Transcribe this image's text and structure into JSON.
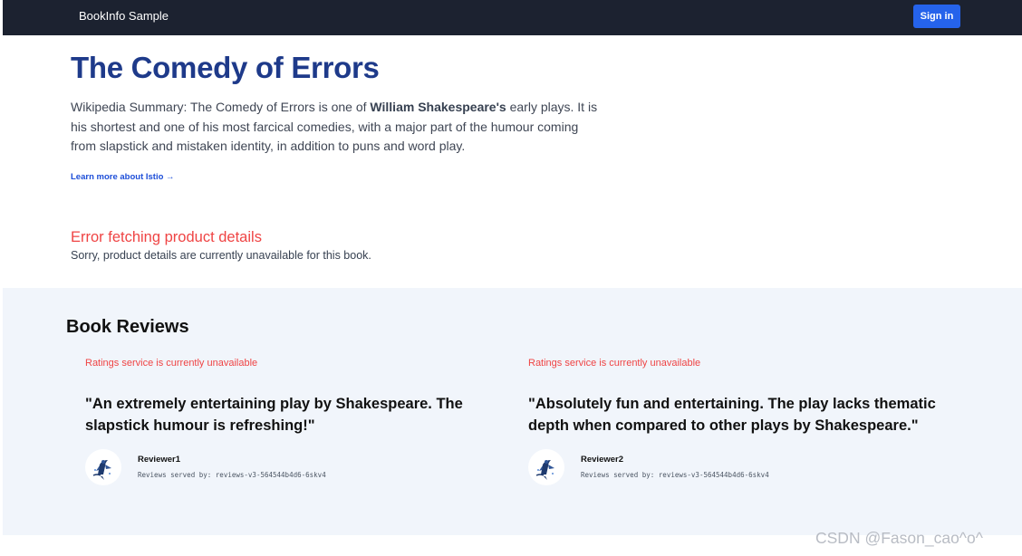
{
  "navbar": {
    "brand": "BookInfo Sample",
    "sign_in_label": "Sign in"
  },
  "product": {
    "title": "The Comedy of Errors",
    "summary_prefix": "Wikipedia Summary: The Comedy of Errors is one of ",
    "summary_bold": "William Shakespeare's",
    "summary_suffix": " early plays. It is his shortest and one of his most farcical comedies, with a major part of the humour coming from slapstick and mistaken identity, in addition to puns and word play.",
    "learn_more": "Learn more about Istio →"
  },
  "details": {
    "error_title": "Error fetching product details",
    "error_text": "Sorry, product details are currently unavailable for this book."
  },
  "reviews": {
    "heading": "Book Reviews",
    "items": [
      {
        "rating_error": "Ratings service is currently unavailable",
        "quote": "\"An extremely entertaining play by Shakespeare. The slapstick humour is refreshing!\"",
        "reviewer": "Reviewer1",
        "served_by": "Reviews served by: reviews-v3-564544b4d6-6skv4"
      },
      {
        "rating_error": "Ratings service is currently unavailable",
        "quote": "\"Absolutely fun and entertaining. The play lacks thematic depth when compared to other plays by Shakespeare.\"",
        "reviewer": "Reviewer2",
        "served_by": "Reviews served by: reviews-v3-564544b4d6-6skv4"
      }
    ]
  },
  "watermark": "CSDN @Fason_cao^o^",
  "icons": {
    "avatar": "istio-sailor-icon"
  },
  "colors": {
    "navbar_bg": "#1c2230",
    "sign_in_bg": "#2563eb",
    "title": "#1e3a8a",
    "error": "#ef4444",
    "reviews_bg": "#f1f5fb"
  }
}
